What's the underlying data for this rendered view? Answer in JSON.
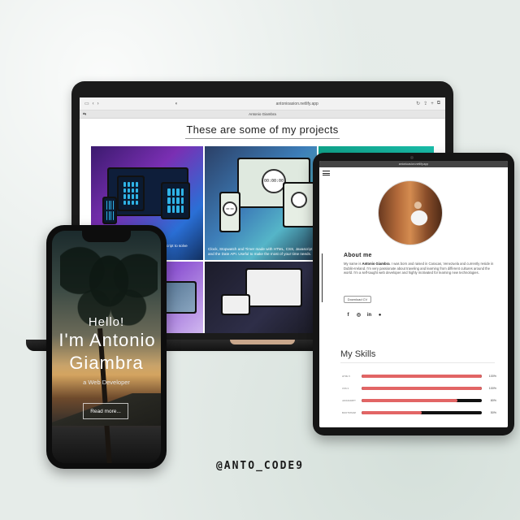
{
  "laptop": {
    "url": "antonioasion.netlify.app",
    "tab_title": "Antonio Giambra",
    "projects_title": "These are some of my projects",
    "project_captions": [
      "…script to solve",
      "Clock, Stopwatch and Timer made with HTML, CSS, Javascript and the Date API. Useful to make the most of your time needs."
    ],
    "clock_readouts": [
      "00:00:00",
      "00:00"
    ]
  },
  "phone": {
    "hello": "Hello!",
    "name_line1": "I'm Antonio",
    "name_line2": "Giambra",
    "role": "a Web Developer",
    "read_more": "Read more..."
  },
  "tablet": {
    "status_url": "antonioasion.netlify.app",
    "about_title": "About me",
    "about_pre": "My name is ",
    "about_name": "Antonio Giambra",
    "about_post": ". I was born and raised in Caracas, Venezuela and currently reside in Dublin-Ireland. I'm very passionate about traveling and learning from different cultures around the world. I'm a self-taught web developer and highly motivated for learning new technologies.",
    "download_cv": "Download CV",
    "social_icons": [
      "facebook-icon",
      "instagram-icon",
      "linkedin-icon",
      "github-icon"
    ],
    "skills_title": "My Skills",
    "skills": [
      {
        "label": "HTML 5",
        "value": 100,
        "pct": "100%"
      },
      {
        "label": "CSS 3",
        "value": 100,
        "pct": "100%"
      },
      {
        "label": "JavaScript",
        "value": 80,
        "pct": "80%"
      },
      {
        "label": "Bootstrap",
        "value": 50,
        "pct": "50%"
      }
    ]
  },
  "handle": "@ANTO_CODE9",
  "colors": {
    "skill_fill": "#e26565",
    "background": "#e6ece9"
  }
}
